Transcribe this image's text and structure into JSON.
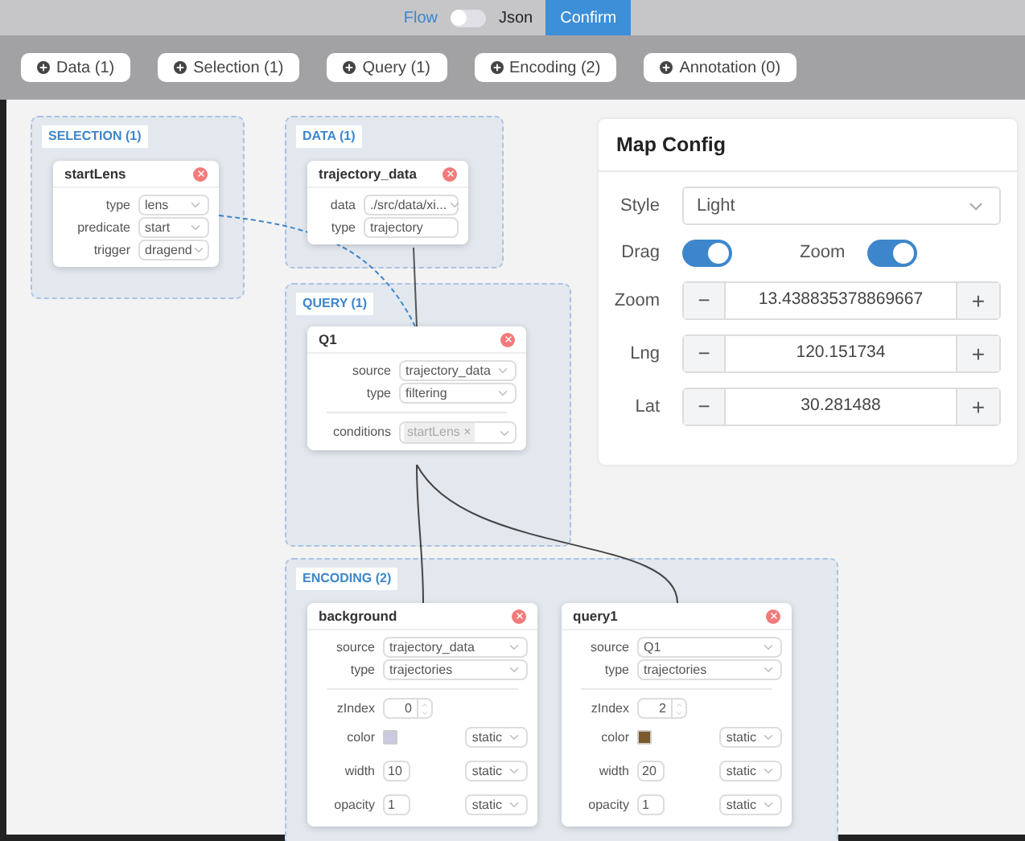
{
  "view_toggle": {
    "left_label": "Flow",
    "right_label": "Json",
    "on": false
  },
  "confirm_button": "Confirm",
  "add_buttons": [
    "Data (1)",
    "Selection (1)",
    "Query (1)",
    "Encoding (2)",
    "Annotation (0)"
  ],
  "groups": [
    {
      "title": "SELECTION (1)"
    },
    {
      "title": "DATA (1)"
    },
    {
      "title": "QUERY (1)"
    },
    {
      "title": "ENCODING (2)"
    }
  ],
  "nodes": [
    {
      "title": "startLens",
      "sections": [
        [
          {
            "label": "type",
            "value": "lens",
            "kind": "select"
          },
          {
            "label": "predicate",
            "value": "start",
            "kind": "select"
          },
          {
            "label": "trigger",
            "value": "dragend",
            "kind": "select"
          }
        ]
      ]
    },
    {
      "title": "trajectory_data",
      "sections": [
        [
          {
            "label": "data",
            "value": "./src/data/xi...",
            "kind": "select"
          },
          {
            "label": "type",
            "value": "trajectory",
            "kind": "input"
          }
        ]
      ]
    },
    {
      "title": "Q1",
      "sections": [
        [
          {
            "label": "source",
            "value": "trajectory_data",
            "kind": "select"
          },
          {
            "label": "type",
            "value": "filtering",
            "kind": "select"
          }
        ],
        [
          {
            "label": "conditions",
            "kind": "tags",
            "tags": [
              {
                "label": "startLens",
                "remove": "×"
              }
            ]
          }
        ]
      ]
    },
    {
      "title": "background",
      "sections": [
        [
          {
            "label": "source",
            "value": "trajectory_data",
            "kind": "select"
          },
          {
            "label": "type",
            "value": "trajectories",
            "kind": "select"
          }
        ],
        [
          {
            "label": "zIndex",
            "value": "0",
            "kind": "number"
          },
          {
            "label": "color",
            "kind": "color",
            "color": "#c9c9e0",
            "mode": "static"
          },
          {
            "label": "width",
            "value": "10",
            "kind": "input",
            "mode": "static"
          },
          {
            "label": "opacity",
            "value": "1",
            "kind": "input",
            "mode": "static"
          }
        ]
      ]
    },
    {
      "title": "query1",
      "sections": [
        [
          {
            "label": "source",
            "value": "Q1",
            "kind": "select"
          },
          {
            "label": "type",
            "value": "trajectories",
            "kind": "select"
          }
        ],
        [
          {
            "label": "zIndex",
            "value": "2",
            "kind": "number"
          },
          {
            "label": "color",
            "kind": "color",
            "color": "#7a5a2e",
            "mode": "static"
          },
          {
            "label": "width",
            "value": "20",
            "kind": "input",
            "mode": "static"
          },
          {
            "label": "opacity",
            "value": "1",
            "kind": "input",
            "mode": "static"
          }
        ]
      ]
    }
  ],
  "map_config": {
    "title": "Map Config",
    "style": {
      "label": "Style",
      "value": "Light"
    },
    "switches": [
      {
        "label": "Drag",
        "on": true
      },
      {
        "label": "Zoom",
        "on": true
      }
    ],
    "steppers": [
      {
        "label": "Zoom",
        "value": "13.438835378869667",
        "minus": "−",
        "plus": "+"
      },
      {
        "label": "Lng",
        "value": "120.151734",
        "minus": "−",
        "plus": "+"
      },
      {
        "label": "Lat",
        "value": "30.281488",
        "minus": "−",
        "plus": "+"
      }
    ]
  }
}
